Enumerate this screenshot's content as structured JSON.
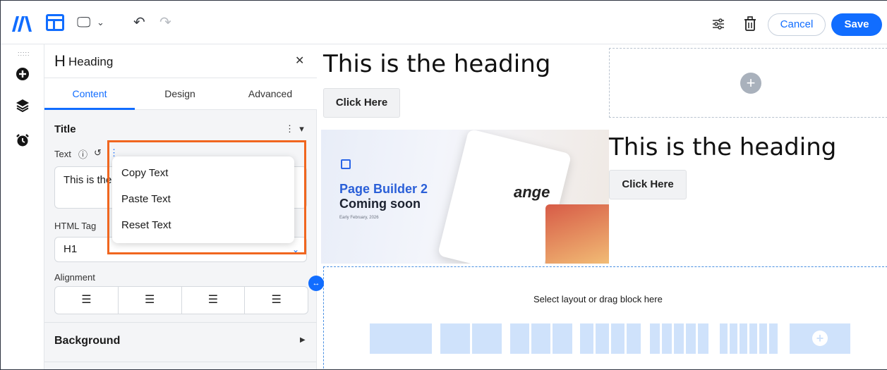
{
  "toolbar": {
    "logo": "wix-logo-icon",
    "layout_icon": "layout-icon",
    "device_icon": "desktop-icon",
    "undo_icon": "undo-icon",
    "redo_icon": "redo-icon",
    "settings_icon": "sliders-icon",
    "delete_icon": "trash-icon",
    "cancel_label": "Cancel",
    "save_label": "Save"
  },
  "rail": {
    "items": [
      "drag-handle-icon",
      "add-icon",
      "layers-icon",
      "alarm-icon"
    ]
  },
  "panel": {
    "title": "Heading",
    "tabs": [
      {
        "label": "Content",
        "active": true
      },
      {
        "label": "Design",
        "active": false
      },
      {
        "label": "Advanced",
        "active": false
      }
    ],
    "section_title": "Title",
    "text_label": "Text",
    "text_value": "This is the",
    "html_tag_label": "HTML Tag",
    "html_tag_value": "H1",
    "alignment_label": "Alignment",
    "background_label": "Background"
  },
  "context_menu": {
    "items": [
      "Copy Text",
      "Paste Text",
      "Reset Text"
    ]
  },
  "canvas": {
    "heading_1": "This is the heading",
    "button_1": "Click Here",
    "heading_2": "This is the heading",
    "button_2": "Click Here",
    "promo_title": "Page Builder 2",
    "promo_subtitle": "Coming soon",
    "promo_date": "Early February, 2026",
    "promo_overlay_text": "ange",
    "dropzone_text": "Select layout or drag block here"
  },
  "colors": {
    "accent": "#116dff",
    "highlight": "#f0661f",
    "layout_block": "#cfe2fb"
  }
}
